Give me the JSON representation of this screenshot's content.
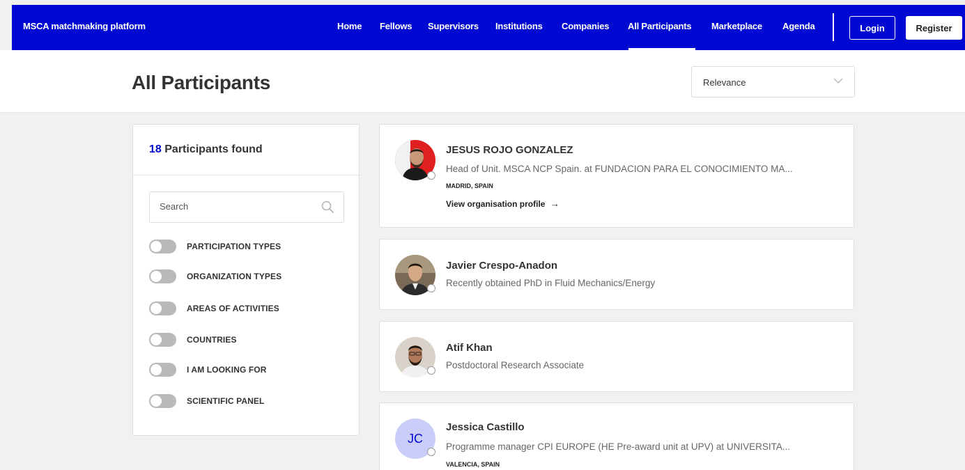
{
  "nav": {
    "brand": "MSCA matchmaking platform",
    "links": [
      "Home",
      "Fellows",
      "Supervisors",
      "Institutions",
      "Companies",
      "All Participants",
      "Marketplace",
      "Agenda"
    ],
    "active": "All Participants",
    "login": "Login",
    "register": "Register",
    "bg_color": "#0009d1"
  },
  "page": {
    "title": "All Participants",
    "sort": {
      "selected": "Relevance"
    }
  },
  "filters": {
    "count": "18",
    "count_label": "Participants found",
    "search_placeholder": "Search",
    "toggles": [
      "PARTICIPATION TYPES",
      "ORGANIZATION TYPES",
      "AREAS OF ACTIVITIES",
      "COUNTRIES",
      "I AM LOOKING FOR",
      "SCIENTIFIC PANEL"
    ]
  },
  "participants": [
    {
      "name": "JESUS ROJO GONZALEZ",
      "title": "Head of Unit. MSCA NCP Spain. at FUNDACION PARA EL CONOCIMIENTO MA...",
      "location": "MADRID, SPAIN",
      "link": "View organisation profile",
      "avatar": "photo-icon"
    },
    {
      "name": "Javier Crespo-Anadon",
      "title": "Recently obtained PhD in Fluid Mechanics/Energy",
      "avatar": "photo-icon"
    },
    {
      "name": "Atif Khan",
      "title": "Postdoctoral Research Associate",
      "avatar": "photo-icon"
    },
    {
      "name": "Jessica Castillo",
      "title": "Programme manager CPI EUROPE (HE Pre-award unit at UPV) at UNIVERSITA...",
      "location": "VALENCIA, SPAIN",
      "initials": "JC"
    }
  ]
}
